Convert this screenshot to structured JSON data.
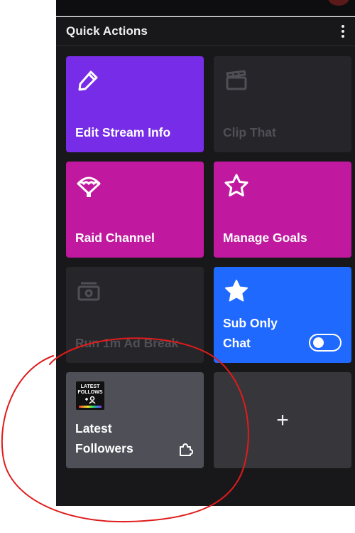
{
  "panel": {
    "title": "Quick Actions"
  },
  "tiles": [
    {
      "label": "Edit Stream Info",
      "icon": "pencil-icon",
      "state": "enabled",
      "color": "#772ce8"
    },
    {
      "label": "Clip That",
      "icon": "clapperboard-icon",
      "state": "disabled",
      "color": "#26262a"
    },
    {
      "label": "Raid Channel",
      "icon": "parachute-icon",
      "state": "enabled",
      "color": "#c0199f"
    },
    {
      "label": "Manage Goals",
      "icon": "star-outline-icon",
      "state": "enabled",
      "color": "#c0199f"
    },
    {
      "label": "Run 1m Ad Break",
      "icon": "ad-icon",
      "state": "disabled",
      "color": "#26262a"
    },
    {
      "label": "Sub Only Chat",
      "label_line1": "Sub Only",
      "label_line2": "Chat",
      "icon": "star-filled-icon",
      "state": "enabled",
      "toggle_on": false,
      "color": "#1f69ff"
    },
    {
      "label": "Latest Followers",
      "label_line1": "Latest",
      "label_line2": "Followers",
      "icon": "extension-puzzle-icon",
      "state": "enabled",
      "color": "#4f4f58",
      "thumbnail": {
        "line1": "LATEST",
        "line2": "FOLLOWS"
      }
    },
    {
      "label": "+",
      "icon": "plus-icon",
      "state": "enabled",
      "color": "#36363b"
    }
  ],
  "colors": {
    "panel_bg": "#18181b",
    "annotation": "#e01b1b"
  }
}
